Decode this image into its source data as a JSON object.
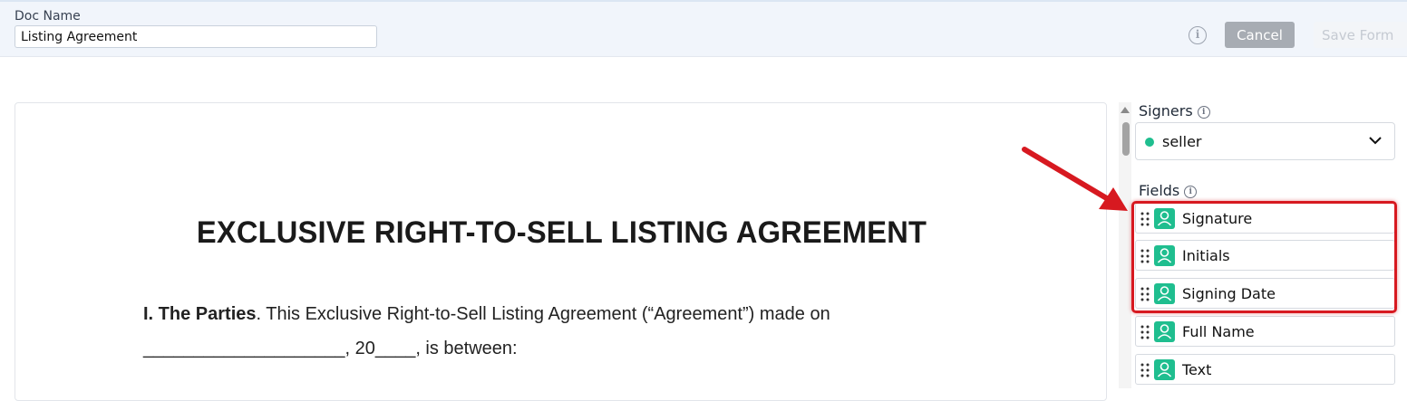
{
  "header": {
    "doc_name_label": "Doc Name",
    "doc_name_value": "Listing Agreement",
    "info_icon": "info-icon",
    "cancel_label": "Cancel",
    "save_label": "Save Form"
  },
  "document": {
    "title": "EXCLUSIVE RIGHT-TO-SELL LISTING AGREEMENT",
    "para1_bold": "I. The Parties",
    "para1_rest": ". This Exclusive Right-to-Sell Listing Agreement (“Agreement”) made on",
    "para2": "____________________, 20____, is between:"
  },
  "sidebar": {
    "signers_label": "Signers",
    "signer_selected": "seller",
    "signer_color": "#1fbe8f",
    "fields_label": "Fields",
    "fields": [
      {
        "label": "Signature",
        "icon": "user-icon"
      },
      {
        "label": "Initials",
        "icon": "user-icon"
      },
      {
        "label": "Signing Date",
        "icon": "user-icon"
      },
      {
        "label": "Full Name",
        "icon": "user-icon"
      },
      {
        "label": "Text",
        "icon": "user-icon"
      }
    ]
  },
  "annotation": {
    "color": "#d71920",
    "highlighted_fields": [
      "Signature",
      "Initials",
      "Signing Date"
    ]
  }
}
